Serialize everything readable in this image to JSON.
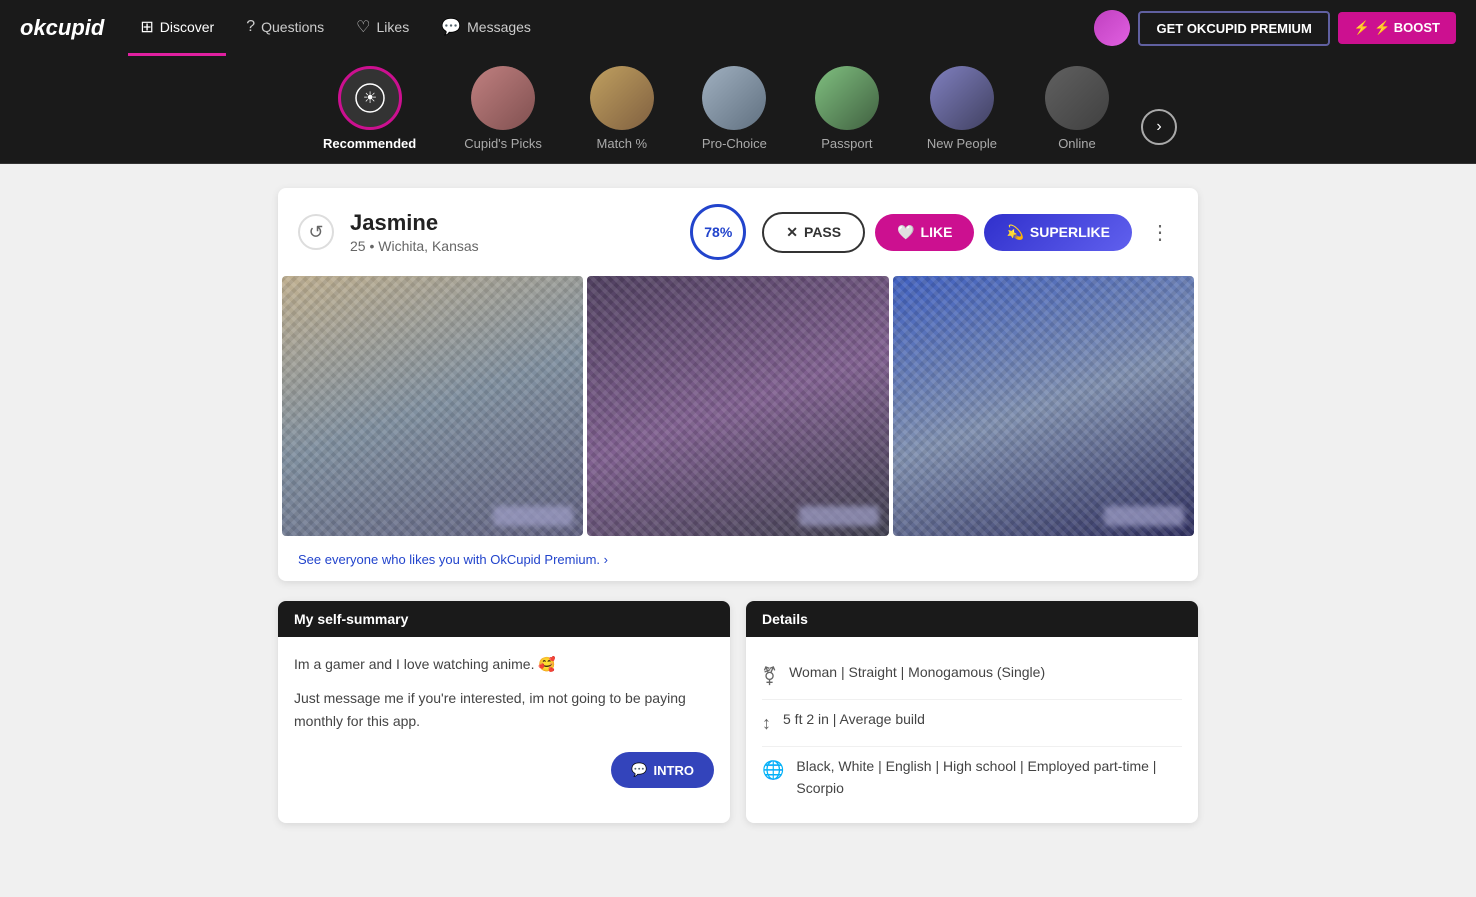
{
  "brand": {
    "name": "okcupid"
  },
  "navbar": {
    "items": [
      {
        "id": "discover",
        "label": "Discover",
        "icon": "⊞",
        "active": true
      },
      {
        "id": "questions",
        "label": "Questions",
        "icon": "❓",
        "active": false
      },
      {
        "id": "likes",
        "label": "Likes",
        "icon": "♡",
        "active": false
      },
      {
        "id": "messages",
        "label": "Messages",
        "icon": "💬",
        "active": false
      }
    ],
    "premium_btn": "GET OKCUPID PREMIUM",
    "boost_btn": "⚡ BOOST"
  },
  "categories": [
    {
      "id": "recommended",
      "label": "Recommended",
      "active": true,
      "icon": "sun-heart"
    },
    {
      "id": "cupids-picks",
      "label": "Cupid's Picks",
      "active": false
    },
    {
      "id": "match",
      "label": "Match %",
      "active": false
    },
    {
      "id": "pro-choice",
      "label": "Pro-Choice",
      "active": false
    },
    {
      "id": "passport",
      "label": "Passport",
      "active": false
    },
    {
      "id": "new-people",
      "label": "New People",
      "active": false
    },
    {
      "id": "online",
      "label": "Online",
      "active": false
    }
  ],
  "profile": {
    "name": "Jasmine",
    "age": "25",
    "location": "Wichita, Kansas",
    "match_percent": "78%",
    "pass_label": "PASS",
    "like_label": "LIKE",
    "superlike_label": "SUPERLIKE",
    "premium_prompt": "See everyone who likes you with OkCupid Premium. ›",
    "self_summary_header": "My self-summary",
    "self_summary_p1": "Im a gamer and I love watching anime. 🥰",
    "self_summary_p2": "Just message me if you're interested, im not going to be paying monthly for this app.",
    "details_header": "Details",
    "details": [
      {
        "icon": "♀",
        "text": "Woman | Straight | Monogamous (Single)"
      },
      {
        "icon": "↕",
        "text": "5 ft 2 in | Average build"
      },
      {
        "icon": "🌐",
        "text": "Black, White | English | High school | Employed part-time | Scorpio"
      }
    ],
    "intro_btn": "INTRO"
  }
}
